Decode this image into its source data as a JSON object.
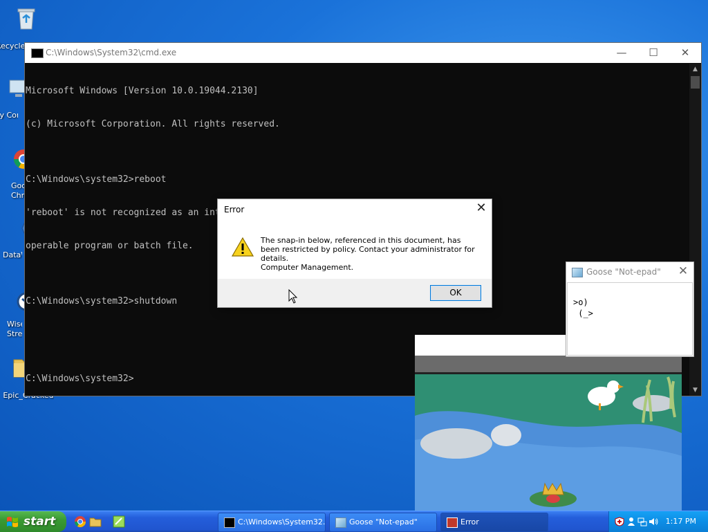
{
  "desktop": {
    "icons": [
      {
        "label": "Recycle Bin",
        "icon": "recycle-bin-icon"
      },
      {
        "label": "My Computer",
        "icon": "computer-icon"
      },
      {
        "label": "Google Chrome",
        "icon": "chrome-icon"
      },
      {
        "label": "DataWrangler",
        "icon": "data-icon"
      },
      {
        "label": "Wise Stress",
        "icon": "wise-icon"
      },
      {
        "label": "Epic_Cracked",
        "icon": "folder-icon"
      }
    ]
  },
  "cmd": {
    "title": "C:\\Windows\\System32\\cmd.exe",
    "lines": [
      "Microsoft Windows [Version 10.0.19044.2130]",
      "(c) Microsoft Corporation. All rights reserved.",
      "",
      "C:\\Windows\\system32>reboot",
      "'reboot' is not recognized as an internal or external command,",
      "operable program or batch file.",
      "",
      "C:\\Windows\\system32>shutdown",
      "",
      "",
      "C:\\Windows\\system32>"
    ]
  },
  "error_dialog": {
    "title": "Error",
    "message": "The snap-in below, referenced in this document, has been restricted by policy. Contact your administrator for details.",
    "detail": "Computer Management.",
    "ok_label": "OK"
  },
  "goose_note": {
    "title": "Goose \"Not-epad\"",
    "text_line1": ">o)",
    "text_line2": " (_>"
  },
  "taskbar": {
    "start_label": "start",
    "tasks": [
      {
        "label": "C:\\Windows\\System32...",
        "active": false
      },
      {
        "label": "Goose \"Not-epad\"",
        "active": false
      },
      {
        "label": "Error",
        "active": true
      }
    ],
    "clock": "1:17 PM"
  },
  "colors": {
    "desktop_blue": "#1a72d9",
    "taskbar_blue": "#245edb",
    "start_green": "#3a9a34",
    "console_bg": "#0c0c0c",
    "console_text": "#c0c0c0"
  }
}
